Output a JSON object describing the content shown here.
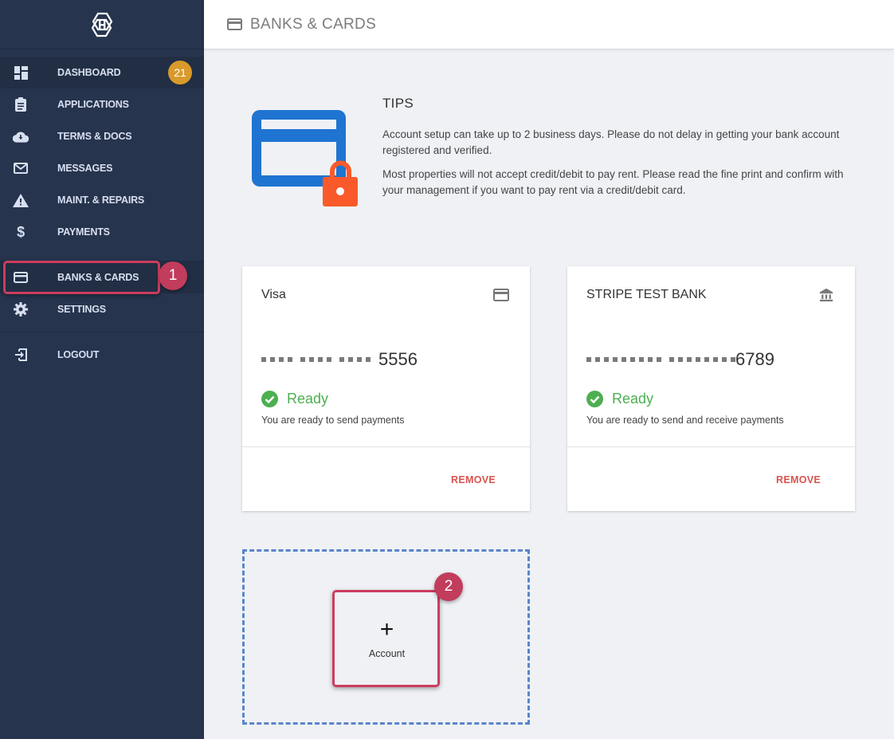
{
  "sidebar": {
    "logo": "hexagon-logo",
    "items": [
      {
        "label": "DASHBOARD",
        "icon": "dashboard-icon",
        "badge": "21"
      },
      {
        "label": "APPLICATIONS",
        "icon": "clipboard-icon"
      },
      {
        "label": "TERMS & DOCS",
        "icon": "cloud-download-icon"
      },
      {
        "label": "MESSAGES",
        "icon": "mail-icon"
      },
      {
        "label": "MAINT. & REPAIRS",
        "icon": "warning-icon"
      },
      {
        "label": "PAYMENTS",
        "icon": "dollar-icon"
      },
      {
        "label": "BANKS & CARDS",
        "icon": "credit-card-icon",
        "active": true
      },
      {
        "label": "SETTINGS",
        "icon": "gear-icon"
      },
      {
        "label": "LOGOUT",
        "icon": "logout-icon"
      }
    ]
  },
  "header": {
    "title": "BANKS & CARDS",
    "icon": "credit-card-icon"
  },
  "tips": {
    "title": "TIPS",
    "paragraphs": [
      "Account setup can take up to 2 business days. Please do not delay in getting your bank account registered and verified.",
      "Most properties will not accept credit/debit to pay rent. Please read the fine print and confirm with your management if you want to pay rent via a credit/debit card."
    ]
  },
  "accounts": [
    {
      "name": "Visa",
      "type_icon": "credit-card-icon",
      "mask_groups": [
        4,
        4,
        4
      ],
      "last4": "5556",
      "status": "Ready",
      "status_desc": "You are ready to send payments",
      "remove_label": "REMOVE"
    },
    {
      "name": "STRIPE TEST BANK",
      "type_icon": "bank-icon",
      "mask_groups": [
        9,
        8
      ],
      "last4": "6789",
      "status": "Ready",
      "status_desc": "You are ready to send and receive payments",
      "remove_label": "REMOVE"
    }
  ],
  "add_account": {
    "plus": "+",
    "label": "Account"
  },
  "annotations": [
    {
      "number": "1",
      "target": "BANKS & CARDS"
    },
    {
      "number": "2",
      "target": "Account"
    }
  ],
  "colors": {
    "sidebar_bg": "#26344d",
    "badge": "#d99a2b",
    "ready_green": "#4caf50",
    "remove_red": "#d9534f",
    "annotation": "#cc3d5e",
    "dashed_border": "#5a85c9",
    "card_blue": "#1f74d1",
    "lock_orange": "#fa5a2a"
  }
}
